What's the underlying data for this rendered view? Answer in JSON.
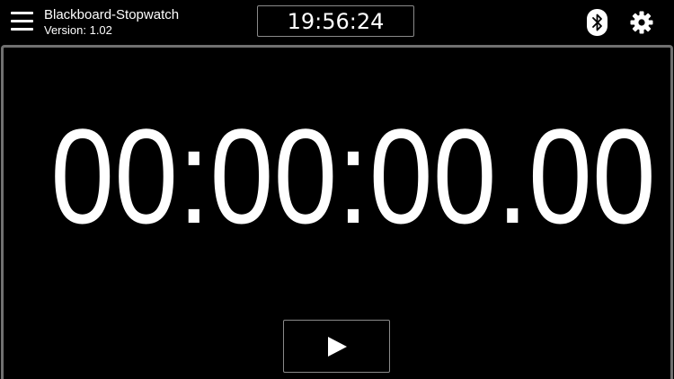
{
  "header": {
    "app_title": "Blackboard-Stopwatch",
    "version": "Version: 1.02",
    "clock": "19:56:24",
    "icons": {
      "menu": "menu-icon",
      "bluetooth": "bluetooth-icon",
      "settings": "gear-icon"
    }
  },
  "main": {
    "timer": "00:00:00.00",
    "controls": {
      "play_icon": "play-icon"
    }
  },
  "colors": {
    "background": "#000000",
    "text": "#ffffff",
    "border": "#707070"
  }
}
